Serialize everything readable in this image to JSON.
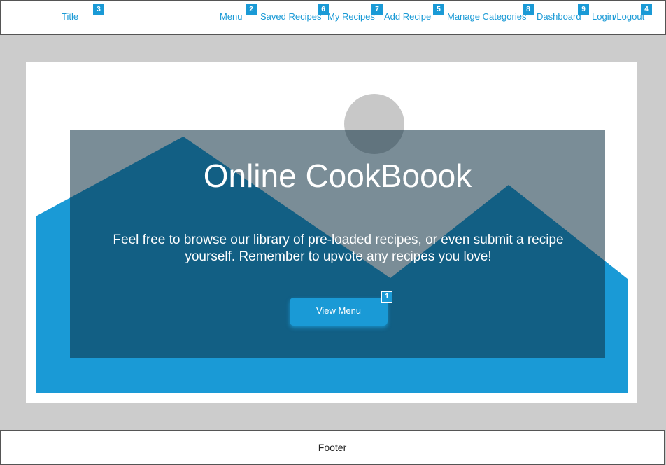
{
  "header": {
    "title": "Title",
    "nav": {
      "menu": "Menu",
      "saved_recipes": "Saved Recipes",
      "my_recipes": "My Recipes",
      "add_recipe": "Add Recipe",
      "manage_categories": "Manage Categories",
      "dashboard": "Dashboard",
      "login_logout": "Login/Logout"
    },
    "badges": {
      "title": "3",
      "menu": "2",
      "saved_recipes": "6",
      "my_recipes": "7",
      "add_recipe": "5",
      "manage_categories": "8",
      "dashboard": "9",
      "login_logout": "4",
      "view_menu": "1"
    }
  },
  "hero": {
    "title": "Online CookBoook",
    "description": "Feel free to browse our library of pre-loaded recipes, or even submit a recipe yourself. Remember to upvote any recipes you love!",
    "button_label": "View Menu"
  },
  "footer": {
    "text": "Footer"
  },
  "colors": {
    "accent": "#1a9ad6",
    "overlay": "#0d2f42",
    "page_background": "#cccccc",
    "placeholder_gray": "#c8c8c8"
  }
}
